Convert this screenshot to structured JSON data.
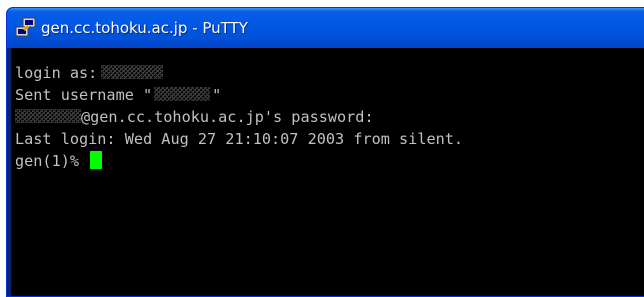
{
  "window": {
    "title": "gen.cc.tohoku.ac.jp - PuTTY",
    "icon": "putty-icon"
  },
  "terminal": {
    "line1_prefix": "login as:",
    "line2_prefix": "Sent username \"",
    "line2_suffix": "\"",
    "line3_suffix": "@gen.cc.tohoku.ac.jp's password:",
    "line4": "Last login: Wed Aug 27 21:10:07 2003 from silent.",
    "prompt": "gen(1)% "
  },
  "colors": {
    "background": "#000000",
    "text": "#c0c0c0",
    "cursor": "#00ff00",
    "titlebar": "#0058e6"
  }
}
